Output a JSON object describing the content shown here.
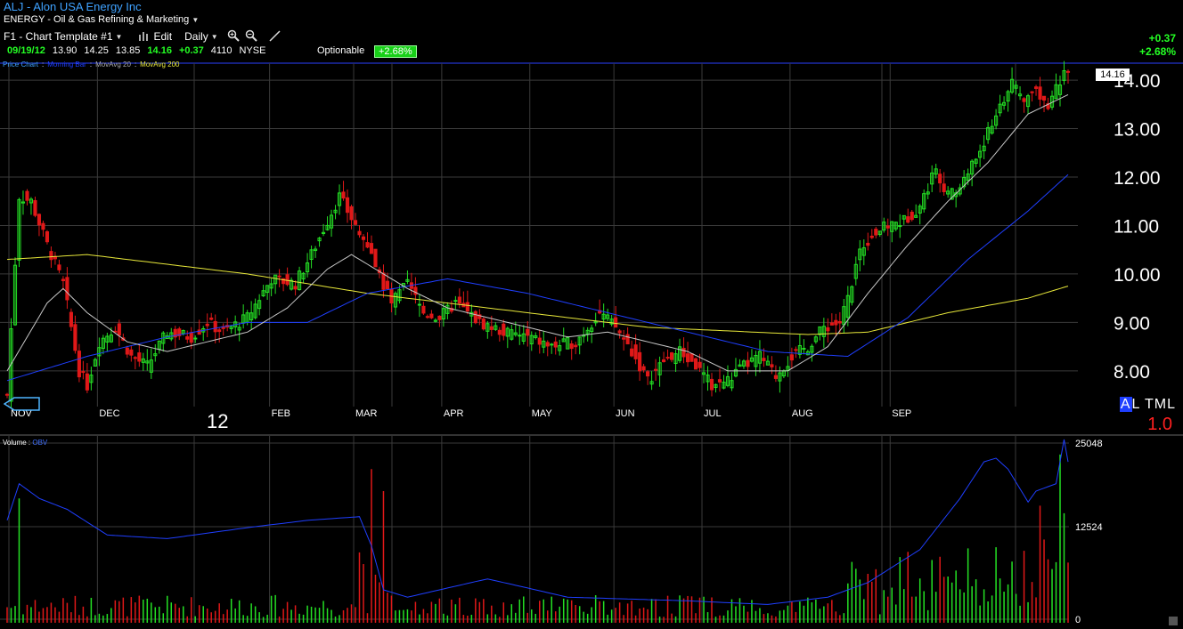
{
  "header": {
    "title": "ALJ - Alon USA Energy Inc",
    "sector": "ENERGY - Oil & Gas Refining & Marketing"
  },
  "toolbar": {
    "template": "F1 - Chart Template #1",
    "edit": "Edit",
    "period": "Daily"
  },
  "quote": {
    "date": "09/19/12",
    "open": "13.90",
    "high": "14.25",
    "low": "13.85",
    "last": "14.16",
    "change": "+0.37",
    "volume": "4110",
    "exchange": "NYSE",
    "optionable": "Optionable",
    "pct_badge": "+2.68%",
    "right_change": "+0.37",
    "right_pct": "+2.68%"
  },
  "legend": {
    "price_chart": "Price Chart",
    "momentum": "Morning Bar",
    "ma20": "MovAvg 20",
    "ma200": "MovAvg 200"
  },
  "price_tag": "14.16",
  "year_label": "12",
  "al_text": {
    "a": "A",
    "rest": "L TML"
  },
  "ratio": "1.0",
  "volume_panel": {
    "volume": "Volume",
    "obv": "OBV",
    "ticks": [
      "25048",
      "12524",
      "0"
    ]
  },
  "colors": {
    "up": "#24e024",
    "down": "#e01818",
    "ma20": "#c8c8c8",
    "ma200": "#e8e83a",
    "obv": "#1f3fff",
    "grid": "#3a3a3a"
  },
  "chart_data": {
    "type": "candlestick",
    "y_ticks": [
      "14.00",
      "13.00",
      "12.00",
      "11.00",
      "10.00",
      "9.00",
      "8.00"
    ],
    "ylim": [
      7.3,
      14.35
    ],
    "months": [
      "NOV",
      "DEC",
      "FEB",
      "MAR",
      "APR",
      "MAY",
      "JUN",
      "JUL",
      "AUG",
      "SEP"
    ],
    "close_keypoints": [
      [
        0,
        7.5
      ],
      [
        3,
        11.6
      ],
      [
        6,
        11.5
      ],
      [
        10,
        10.6
      ],
      [
        14,
        9.8
      ],
      [
        18,
        8.0
      ],
      [
        20,
        7.7
      ],
      [
        23,
        8.6
      ],
      [
        27,
        8.9
      ],
      [
        31,
        8.3
      ],
      [
        35,
        8.1
      ],
      [
        40,
        8.8
      ],
      [
        46,
        8.7
      ],
      [
        50,
        9.0
      ],
      [
        54,
        8.8
      ],
      [
        60,
        9.1
      ],
      [
        66,
        9.9
      ],
      [
        72,
        9.8
      ],
      [
        76,
        10.4
      ],
      [
        80,
        11.1
      ],
      [
        83,
        11.6
      ],
      [
        87,
        11.0
      ],
      [
        92,
        10.2
      ],
      [
        96,
        9.4
      ],
      [
        100,
        9.8
      ],
      [
        104,
        9.2
      ],
      [
        108,
        9.1
      ],
      [
        112,
        9.4
      ],
      [
        118,
        9.0
      ],
      [
        124,
        8.8
      ],
      [
        130,
        8.7
      ],
      [
        136,
        8.5
      ],
      [
        142,
        8.6
      ],
      [
        148,
        9.2
      ],
      [
        152,
        8.9
      ],
      [
        156,
        8.4
      ],
      [
        160,
        7.8
      ],
      [
        164,
        8.2
      ],
      [
        168,
        8.4
      ],
      [
        172,
        8.1
      ],
      [
        176,
        7.7
      ],
      [
        180,
        7.8
      ],
      [
        184,
        8.1
      ],
      [
        188,
        8.3
      ],
      [
        192,
        7.9
      ],
      [
        196,
        8.3
      ],
      [
        200,
        8.5
      ],
      [
        204,
        8.9
      ],
      [
        208,
        9.0
      ],
      [
        210,
        9.5
      ],
      [
        213,
        10.5
      ],
      [
        216,
        10.8
      ],
      [
        220,
        11.0
      ],
      [
        224,
        11.1
      ],
      [
        228,
        11.4
      ],
      [
        232,
        12.2
      ],
      [
        235,
        11.6
      ],
      [
        238,
        11.8
      ],
      [
        242,
        12.4
      ],
      [
        245,
        12.9
      ],
      [
        248,
        13.5
      ],
      [
        251,
        13.9
      ],
      [
        254,
        13.6
      ],
      [
        257,
        13.8
      ],
      [
        260,
        13.5
      ],
      [
        263,
        14.0
      ],
      [
        265,
        14.16
      ]
    ],
    "ma20_keypoints": [
      [
        0,
        8.0
      ],
      [
        10,
        9.4
      ],
      [
        14,
        9.7
      ],
      [
        20,
        9.2
      ],
      [
        30,
        8.6
      ],
      [
        40,
        8.4
      ],
      [
        50,
        8.6
      ],
      [
        60,
        8.8
      ],
      [
        70,
        9.3
      ],
      [
        80,
        10.1
      ],
      [
        86,
        10.4
      ],
      [
        92,
        10.1
      ],
      [
        100,
        9.7
      ],
      [
        110,
        9.3
      ],
      [
        120,
        9.1
      ],
      [
        140,
        8.7
      ],
      [
        150,
        8.8
      ],
      [
        160,
        8.6
      ],
      [
        170,
        8.4
      ],
      [
        180,
        8.0
      ],
      [
        195,
        8.0
      ],
      [
        205,
        8.5
      ],
      [
        215,
        9.6
      ],
      [
        225,
        10.6
      ],
      [
        235,
        11.5
      ],
      [
        245,
        12.3
      ],
      [
        255,
        13.3
      ],
      [
        265,
        13.7
      ]
    ],
    "ma200_keypoints": [
      [
        0,
        10.3
      ],
      [
        20,
        10.4
      ],
      [
        60,
        10.0
      ],
      [
        90,
        9.6
      ],
      [
        130,
        9.2
      ],
      [
        160,
        8.9
      ],
      [
        200,
        8.75
      ],
      [
        215,
        8.8
      ],
      [
        235,
        9.2
      ],
      [
        255,
        9.5
      ],
      [
        265,
        9.75
      ]
    ],
    "ma50_keypoints": [
      [
        0,
        7.8
      ],
      [
        20,
        8.3
      ],
      [
        40,
        8.7
      ],
      [
        60,
        9.0
      ],
      [
        75,
        9.0
      ],
      [
        90,
        9.6
      ],
      [
        110,
        9.9
      ],
      [
        130,
        9.6
      ],
      [
        160,
        9.0
      ],
      [
        190,
        8.4
      ],
      [
        210,
        8.3
      ],
      [
        225,
        9.1
      ],
      [
        240,
        10.3
      ],
      [
        255,
        11.3
      ],
      [
        265,
        12.05
      ]
    ],
    "obv_keypoints": [
      [
        0,
        14000
      ],
      [
        3,
        19000
      ],
      [
        8,
        17000
      ],
      [
        15,
        15500
      ],
      [
        25,
        12000
      ],
      [
        40,
        11500
      ],
      [
        60,
        13000
      ],
      [
        75,
        14000
      ],
      [
        88,
        14500
      ],
      [
        91,
        10500
      ],
      [
        94,
        4500
      ],
      [
        100,
        3500
      ],
      [
        120,
        6000
      ],
      [
        140,
        3500
      ],
      [
        170,
        3000
      ],
      [
        190,
        2500
      ],
      [
        205,
        3500
      ],
      [
        215,
        5500
      ],
      [
        228,
        10000
      ],
      [
        238,
        17000
      ],
      [
        244,
        22000
      ],
      [
        247,
        22500
      ],
      [
        250,
        21000
      ],
      [
        255,
        16500
      ],
      [
        257,
        18000
      ],
      [
        262,
        19000
      ],
      [
        264,
        25048
      ],
      [
        265,
        22000
      ]
    ],
    "volume_ylim": [
      0,
      25048
    ]
  }
}
